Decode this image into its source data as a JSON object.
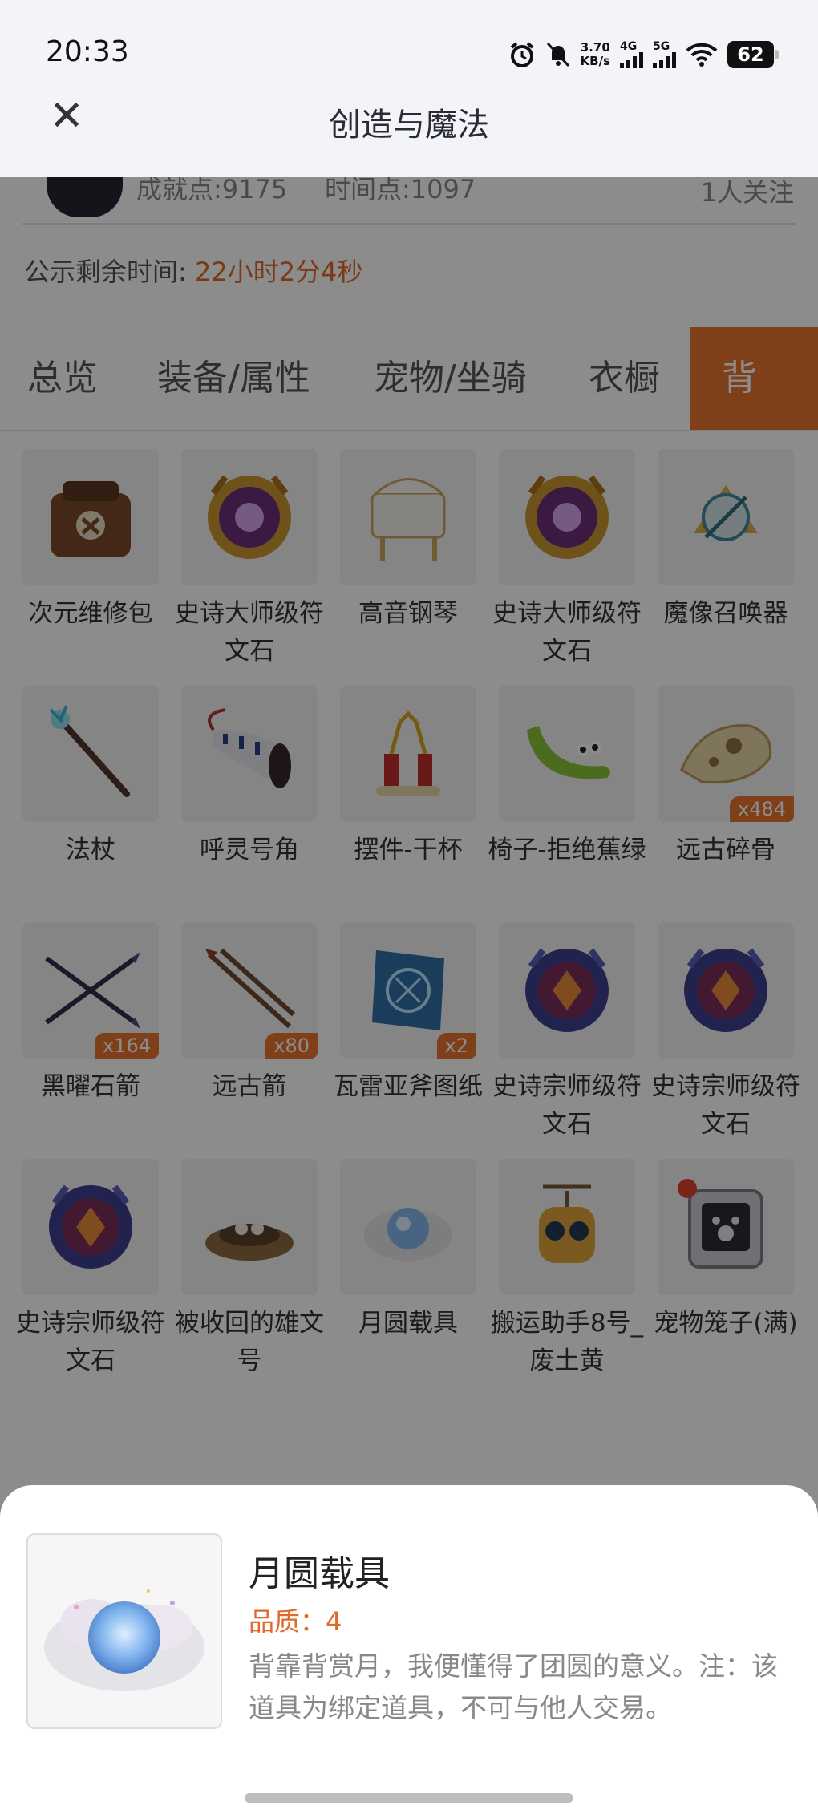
{
  "status_bar": {
    "time": "20:33",
    "net_speed_value": "3.70",
    "net_speed_unit": "KB/s",
    "net1": "4G",
    "net2": "5G",
    "battery": "62",
    "icons": [
      "alarm-icon",
      "mute-icon",
      "wifi-icon"
    ]
  },
  "header": {
    "title": "创造与魔法",
    "close_glyph": "✕"
  },
  "profile": {
    "achievement": "成就点:9175",
    "time_points": "时间点:1097",
    "followers": "1人关注"
  },
  "countdown": {
    "label": "公示剩余时间:",
    "value": "22小时2分4秒"
  },
  "tabs": [
    {
      "label": "总览"
    },
    {
      "label": "装备/属性"
    },
    {
      "label": "宠物/坐骑"
    },
    {
      "label": "衣橱"
    },
    {
      "label": "背包",
      "active": true
    }
  ],
  "items": [
    {
      "name": "次元维修包",
      "count": "",
      "icon": "bag-icon"
    },
    {
      "name": "史诗大师级符文石",
      "count": "",
      "icon": "rune-gold-icon"
    },
    {
      "name": "高音钢琴",
      "count": "",
      "icon": "piano-icon"
    },
    {
      "name": "史诗大师级符文石",
      "count": "",
      "icon": "rune-gold-icon"
    },
    {
      "name": "魔像召唤器",
      "count": "",
      "icon": "summoner-icon"
    },
    {
      "name": "法杖",
      "count": "",
      "icon": "staff-icon"
    },
    {
      "name": "呼灵号角",
      "count": "",
      "icon": "horn-icon"
    },
    {
      "name": "摆件-干杯",
      "count": "",
      "icon": "cheers-icon"
    },
    {
      "name": "椅子-拒绝蕉绿",
      "count": "",
      "icon": "banana-chair-icon"
    },
    {
      "name": "远古碎骨",
      "count": "x484",
      "icon": "bone-icon"
    },
    {
      "name": "黑曜石箭",
      "count": "x164",
      "icon": "obsidian-arrow-icon"
    },
    {
      "name": "远古箭",
      "count": "x80",
      "icon": "ancient-arrow-icon"
    },
    {
      "name": "瓦雷亚斧图纸",
      "count": "x2",
      "icon": "blueprint-icon"
    },
    {
      "name": "史诗宗师级符文石",
      "count": "",
      "icon": "rune-blue-icon"
    },
    {
      "name": "史诗宗师级符文石",
      "count": "",
      "icon": "rune-blue-icon"
    },
    {
      "name": "史诗宗师级符文石",
      "count": "",
      "icon": "rune-blue-icon"
    },
    {
      "name": "被收回的雄文号",
      "count": "",
      "icon": "nest-icon"
    },
    {
      "name": "月圆载具",
      "count": "",
      "icon": "moon-orb-icon"
    },
    {
      "name": "搬运助手8号_废土黄",
      "count": "",
      "icon": "robot-icon"
    },
    {
      "name": "宠物笼子(满)",
      "count": "",
      "icon": "pet-cage-icon"
    }
  ],
  "detail": {
    "name": "月圆载具",
    "quality": "品质：4",
    "description": "背靠背赏月，我便懂得了团圆的意义。注：该道具为绑定道具，不可与他人交易。",
    "icon": "moon-orb-icon"
  },
  "colors": {
    "accent": "#e8742e",
    "overlay": "rgba(0,0,0,0.45)"
  }
}
